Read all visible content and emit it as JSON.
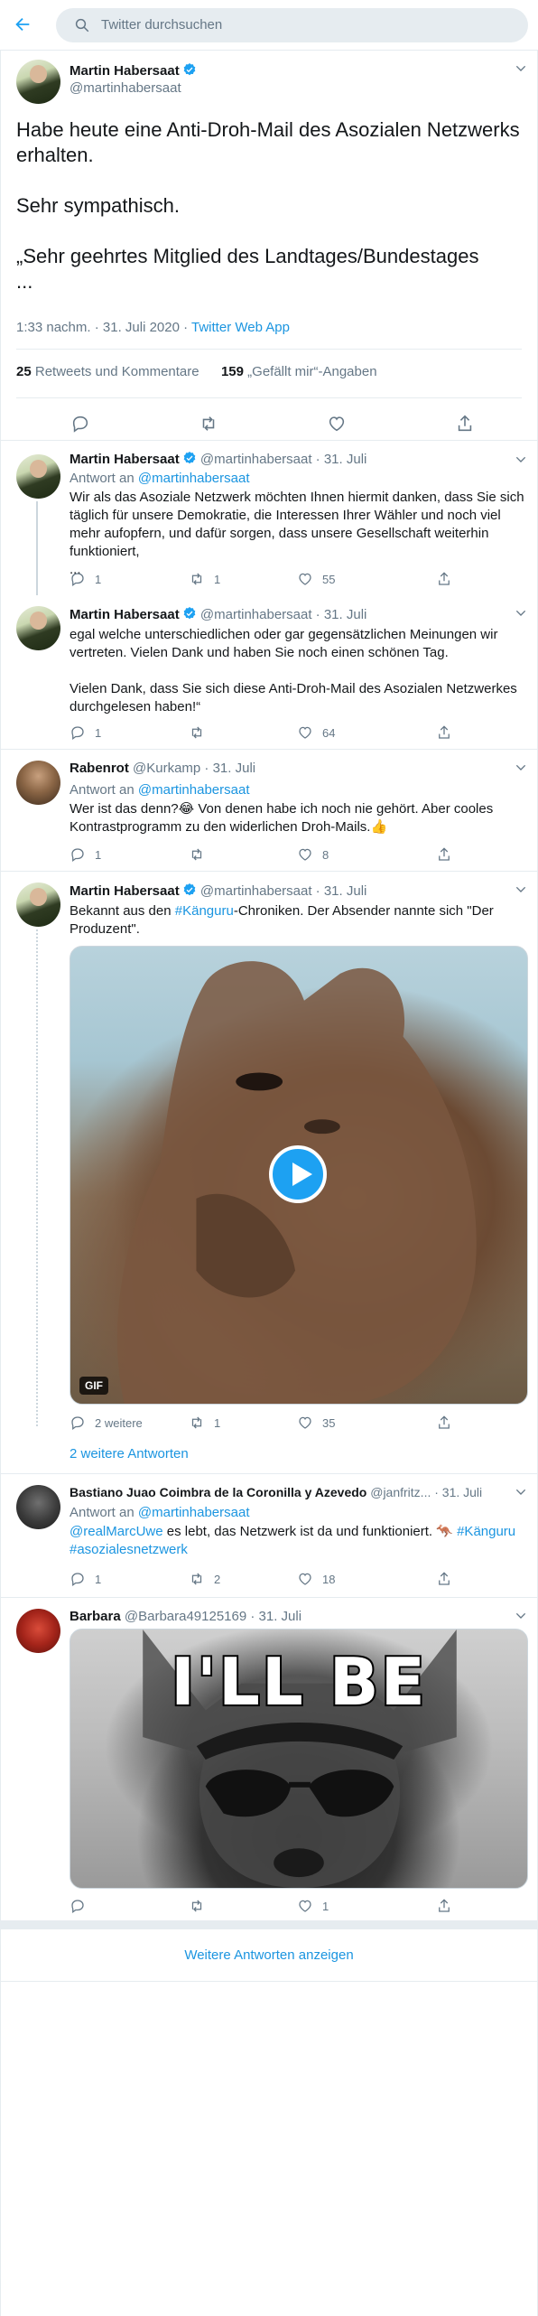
{
  "search": {
    "placeholder": "Twitter durchsuchen"
  },
  "main_tweet": {
    "name": "Martin Habersaat",
    "handle": "@martinhabersaat",
    "text": "Habe heute eine Anti-Droh-Mail des Asozialen Netzwerks erhalten.\n\nSehr sympathisch.\n\n„Sehr geehrtes Mitglied des Landtages/Bundestages\n...",
    "time": "1:33 nachm. · 31. Juli 2020 · ",
    "client": "Twitter Web App",
    "retweets_count": "25",
    "retweets_label": " Retweets und Kommentare",
    "likes_count": "159",
    "likes_label": " „Gefällt mir“-Angaben"
  },
  "replies": [
    {
      "name": "Martin Habersaat",
      "handle": "@martinhabersaat · 31. Juli",
      "reply_prefix": "Antwort an ",
      "reply_to": "@martinhabersaat",
      "text": "Wir als das Asoziale Netzwerk möchten Ihnen hiermit danken, dass Sie sich täglich für unsere Demokratie, die Interessen Ihrer Wähler und noch viel mehr aufopfern, und dafür sorgen, dass unsere Gesellschaft weiterhin funktioniert,\n...",
      "replies": "1",
      "retweets": "1",
      "likes": "55"
    },
    {
      "name": "Martin Habersaat",
      "handle": "@martinhabersaat · 31. Juli",
      "text": "egal welche unterschiedlichen oder gar gegensätzlichen Meinungen wir vertreten. Vielen Dank und haben Sie noch einen schönen Tag.\n\nVielen Dank, dass Sie sich diese Anti-Droh-Mail des Asozialen Netzwerkes durchgelesen haben!“",
      "replies": "1",
      "retweets": "",
      "likes": "64"
    },
    {
      "name": "Rabenrot",
      "handle": "@Kurkamp · 31. Juli",
      "reply_prefix": "Antwort an ",
      "reply_to": "@martinhabersaat",
      "text": "Wer ist das denn?😂 Von denen habe ich noch nie gehört. Aber cooles Kontrastprogramm zu den widerlichen Droh-Mails.👍",
      "replies": "1",
      "retweets": "",
      "likes": "8"
    },
    {
      "name": "Martin Habersaat",
      "handle": "@martinhabersaat · 31. Juli",
      "text_a": "Bekannt aus den ",
      "hashtag": "#Känguru",
      "text_b": "-Chroniken. Der Absender nannte sich \"Der Produzent\".",
      "media_badge": "GIF",
      "replies": "2 weitere",
      "retweets": "1",
      "likes": "35",
      "more_replies": "2 weitere Antworten"
    },
    {
      "name": "Bastiano Juao Coimbra de la Coronilla y Azevedo",
      "handle": "@janfritz... · 31. Juli",
      "reply_prefix": "Antwort an ",
      "reply_to": "@martinhabersaat",
      "mention": "@realMarcUwe",
      "text_a": " es lebt, das Netzwerk ist da und funktioniert. 🦘",
      "hashtag1": "#Känguru",
      "hashtag2": "#asozialesnetzwerk",
      "replies": "1",
      "retweets": "2",
      "likes": "18"
    },
    {
      "name": "Barbara",
      "handle": "@Barbara49125169 · 31. Juli",
      "meme": "I'LL BE",
      "replies": "",
      "retweets": "",
      "likes": "1"
    }
  ],
  "show_more": "Weitere Antworten anzeigen",
  "colors": {
    "accent": "#1da1f2",
    "muted": "#657786",
    "border": "#e6ecf0"
  },
  "icons": [
    "back-arrow-icon",
    "search-icon",
    "verified-badge-icon",
    "chevron-down-icon",
    "reply-icon",
    "retweet-icon",
    "like-icon",
    "share-icon",
    "play-icon"
  ]
}
